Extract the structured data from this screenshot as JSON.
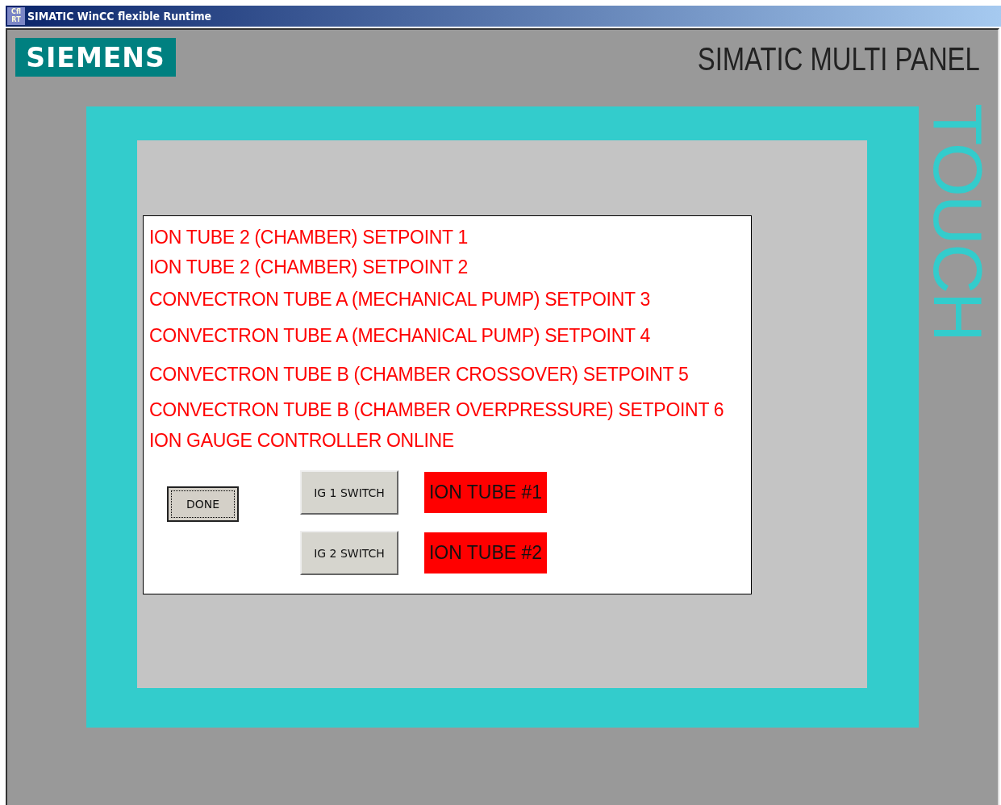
{
  "window": {
    "title": "SIMATIC WinCC flexible Runtime",
    "app_icon": "Cfl RT"
  },
  "panel": {
    "brand": "SIEMENS",
    "model": "SIMATIC MULTI PANEL",
    "touch_label": "TOUCH"
  },
  "dialog": {
    "messages": [
      "ION TUBE 2 (CHAMBER) SETPOINT 1",
      "ION TUBE 2 (CHAMBER) SETPOINT 2",
      "CONVECTRON TUBE A (MECHANICAL PUMP) SETPOINT 3",
      "CONVECTRON TUBE A (MECHANICAL PUMP) SETPOINT 4",
      "CONVECTRON TUBE B (CHAMBER CROSSOVER) SETPOINT 5",
      "CONVECTRON TUBE B (CHAMBER OVERPRESSURE) SETPOINT 6",
      "ION GAUGE CONTROLLER ONLINE"
    ],
    "done_button": {
      "label": "DONE",
      "focused": true
    },
    "switches": [
      {
        "label": "IG 1 SWITCH",
        "indicator": "ION TUBE #1",
        "color": "#ff0000"
      },
      {
        "label": "IG 2 SWITCH",
        "indicator": "ION TUBE #2",
        "color": "#ff0000"
      }
    ]
  }
}
